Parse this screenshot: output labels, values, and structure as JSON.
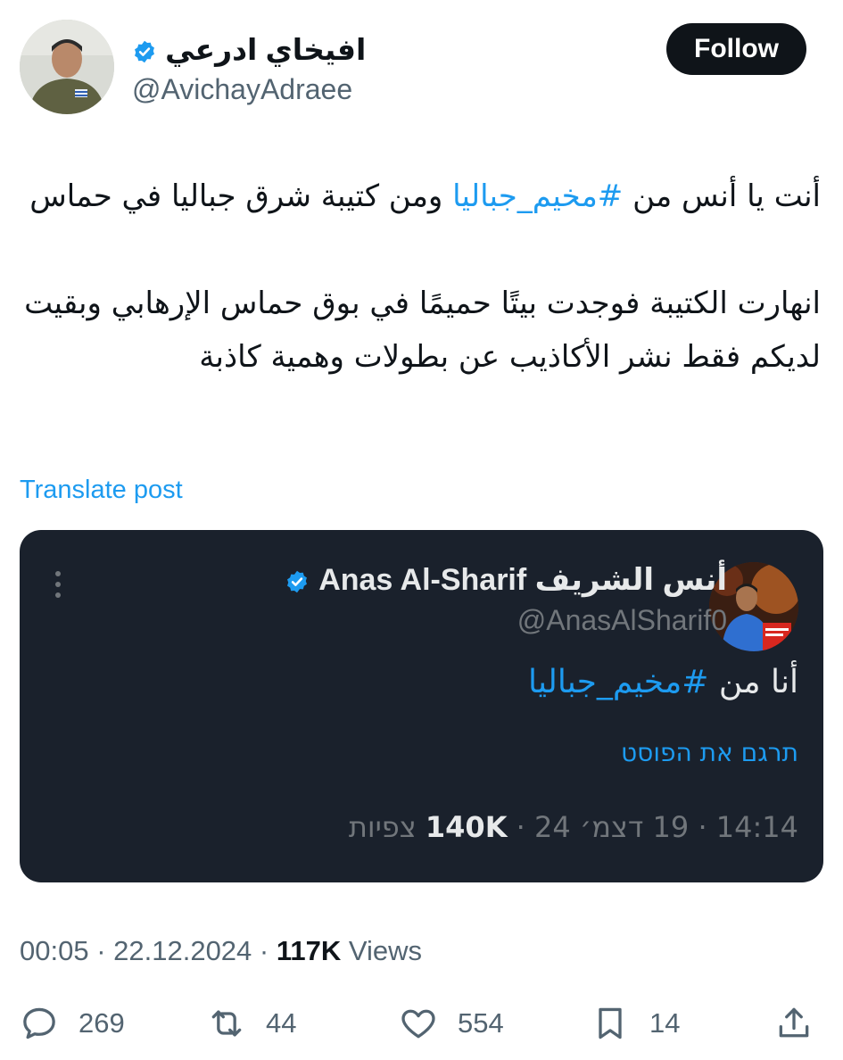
{
  "author": {
    "name": "افيخاي ادرعي",
    "handle": "@AvichayAdraee",
    "verified": true
  },
  "follow_label": "Follow",
  "tweet": {
    "text_before_hashtag": "أنت يا أنس من ",
    "hashtag": "#مخيم_جباليا",
    "text_after_hashtag": " ومن كتيبة شرق جباليا في حماس",
    "paragraph2": "انهارت الكتيبة فوجدت بيتًا حميمًا في بوق حماس الإرهابي وبقيت لديكم فقط نشر الأكاذيب عن بطولات وهمية كاذبة"
  },
  "translate_label": "Translate post",
  "quoted": {
    "name": "Anas Al-Sharif أنس الشريف",
    "handle": "@AnasAlSharif0",
    "verified": true,
    "text_prefix": "أنا من ",
    "hashtag": "#مخيم_جباليا",
    "translate_label": "תרגם את הפוסט",
    "time": "14:14",
    "date": "19 דצמ׳ 24",
    "views_count": "140K",
    "views_label": "צפיות"
  },
  "meta": {
    "time": "00:05",
    "date": "22.12.2024",
    "views_count": "117K",
    "views_label": "Views"
  },
  "actions": {
    "replies": "269",
    "reposts": "44",
    "likes": "554",
    "bookmarks": "14"
  },
  "colors": {
    "accent": "#1d9bf0",
    "card_bg": "#1a212c"
  }
}
